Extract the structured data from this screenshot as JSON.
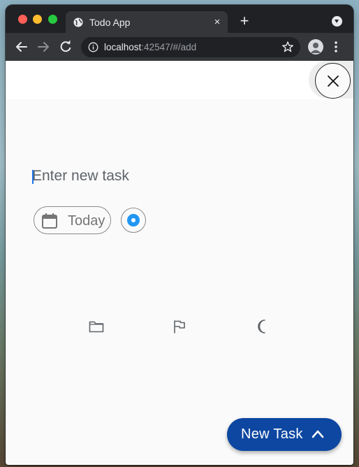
{
  "browser": {
    "tab_title": "Todo App",
    "tab_close": "×",
    "new_tab": "+",
    "url_host": "localhost",
    "url_rest": ":42547/#/add"
  },
  "app": {
    "task_placeholder": "Enter new task",
    "date_chip_label": "Today",
    "priority_color": "#2196f3",
    "fab_label": "New Task",
    "fab_color": "#0d47a1",
    "icons": {
      "close": "close-icon",
      "calendar": "calendar-icon",
      "folder": "folder-icon",
      "flag": "flag-icon",
      "moon": "moon-icon",
      "chevron": "chevron-up-icon"
    }
  }
}
